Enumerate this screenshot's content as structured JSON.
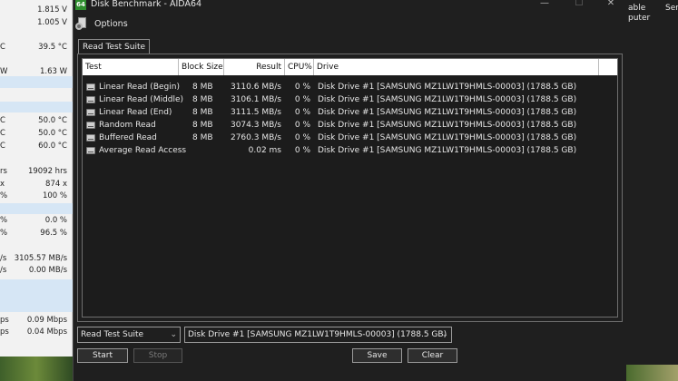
{
  "background_left": {
    "rows": [
      {
        "unit": "",
        "value": "1.815 V"
      },
      {
        "unit": "",
        "value": "1.005 V"
      },
      {
        "unit": "C",
        "value": "39.5 °C"
      },
      {
        "unit": "W",
        "value": "1.63 W"
      },
      {
        "unit": "C",
        "value": "50.0 °C"
      },
      {
        "unit": "C",
        "value": "50.0 °C"
      },
      {
        "unit": "C",
        "value": "60.0 °C"
      },
      {
        "unit": "rs",
        "value": "19092 hrs"
      },
      {
        "unit": "x",
        "value": "874 x"
      },
      {
        "unit": "%",
        "value": "100 %"
      },
      {
        "unit": "%",
        "value": "0.0 %"
      },
      {
        "unit": "%",
        "value": "96.5 %"
      },
      {
        "unit": "/s",
        "value": "3105.57 MB/s"
      },
      {
        "unit": "/s",
        "value": "0.00 MB/s"
      },
      {
        "unit": "ps",
        "value": "0.09 Mbps"
      },
      {
        "unit": "ps",
        "value": "0.04 Mbps"
      }
    ]
  },
  "background_right": {
    "text1": "able",
    "text2": "puter",
    "text3": "Ser"
  },
  "window": {
    "title": "Disk Benchmark - AIDA64",
    "app_icon_text": "64",
    "menu_options": "Options",
    "tab": "Read Test Suite",
    "columns": [
      "Test",
      "Block Size",
      "Result",
      "CPU%",
      "Drive"
    ],
    "rows": [
      {
        "test": "Linear Read (Begin)",
        "block": "8 MB",
        "result": "3110.6 MB/s",
        "cpu": "0 %",
        "drive": "Disk Drive #1  [SAMSUNG MZ1LW1T9HMLS-00003]  (1788.5 GB)"
      },
      {
        "test": "Linear Read (Middle)",
        "block": "8 MB",
        "result": "3106.1 MB/s",
        "cpu": "0 %",
        "drive": "Disk Drive #1  [SAMSUNG MZ1LW1T9HMLS-00003]  (1788.5 GB)"
      },
      {
        "test": "Linear Read (End)",
        "block": "8 MB",
        "result": "3111.5 MB/s",
        "cpu": "0 %",
        "drive": "Disk Drive #1  [SAMSUNG MZ1LW1T9HMLS-00003]  (1788.5 GB)"
      },
      {
        "test": "Random Read",
        "block": "8 MB",
        "result": "3074.3 MB/s",
        "cpu": "0 %",
        "drive": "Disk Drive #1  [SAMSUNG MZ1LW1T9HMLS-00003]  (1788.5 GB)"
      },
      {
        "test": "Buffered Read",
        "block": "8 MB",
        "result": "2760.3 MB/s",
        "cpu": "0 %",
        "drive": "Disk Drive #1  [SAMSUNG MZ1LW1T9HMLS-00003]  (1788.5 GB)"
      },
      {
        "test": "Average Read Access",
        "block": "",
        "result": "0.02 ms",
        "cpu": "0 %",
        "drive": "Disk Drive #1  [SAMSUNG MZ1LW1T9HMLS-00003]  (1788.5 GB)"
      }
    ],
    "suite_select": "Read Test Suite",
    "drive_select": "Disk Drive #1  [SAMSUNG MZ1LW1T9HMLS-00003]  (1788.5 GB)",
    "buttons": {
      "start": "Start",
      "stop": "Stop",
      "save": "Save",
      "clear": "Clear"
    }
  }
}
